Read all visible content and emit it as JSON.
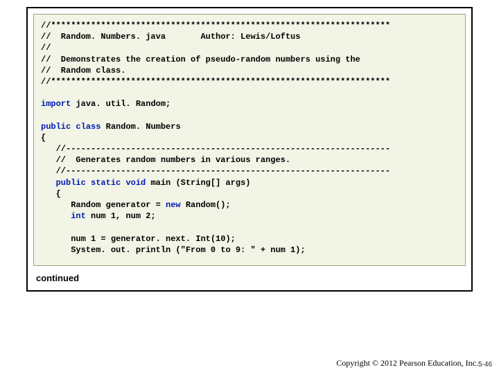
{
  "code": {
    "l01": "//********************************************************************",
    "l02": "//  Random. Numbers. java       Author: Lewis/Loftus",
    "l03": "//",
    "l04": "//  Demonstrates the creation of pseudo-random numbers using the",
    "l05": "//  Random class.",
    "l06": "//********************************************************************",
    "l07a": "import",
    "l07b": " java. util. Random;",
    "l08a": "public",
    "l08b": " ",
    "l08c": "class",
    "l08d": " Random. Numbers",
    "l09": "{",
    "l10": "   //-----------------------------------------------------------------",
    "l11": "   //  Generates random numbers in various ranges.",
    "l12": "   //-----------------------------------------------------------------",
    "l13a": "   public",
    "l13b": " ",
    "l13c": "static",
    "l13d": " ",
    "l13e": "void",
    "l13f": " main (String[] args)",
    "l14": "   {",
    "l15a": "      Random generator = ",
    "l15b": "new",
    "l15c": " Random();",
    "l16a": "      ",
    "l16b": "int",
    "l16c": " num 1, num 2;",
    "l17": " ",
    "l18": "      num 1 = generator. next. Int(10);",
    "l19": "      System. out. println (\"From 0 to 9: \" + num 1);"
  },
  "note": "continued",
  "footer": {
    "copyright": "Copyright © 2012 Pearson Education, Inc.",
    "pagenum": "5-46"
  }
}
